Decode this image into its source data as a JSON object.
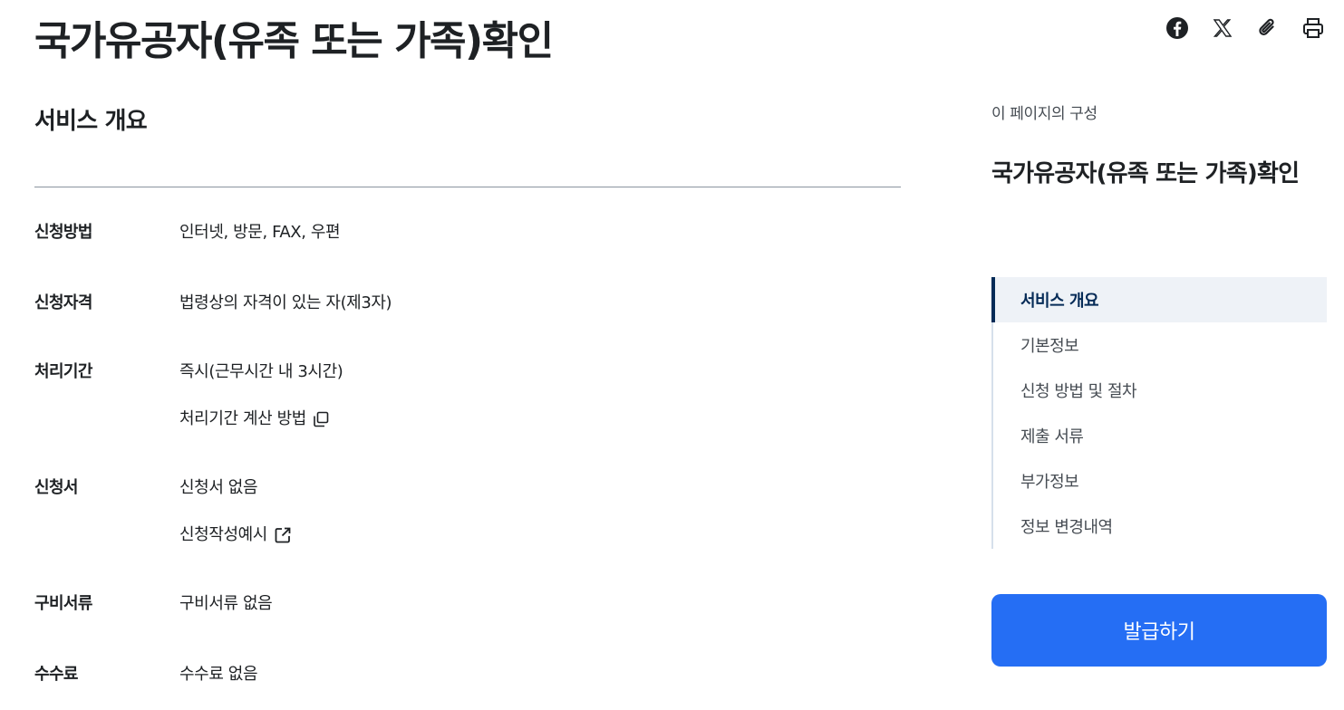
{
  "page": {
    "title": "국가유공자(유족 또는 가족)확인"
  },
  "share": {
    "icons": [
      "facebook-icon",
      "x-icon",
      "paperclip-icon",
      "print-icon"
    ]
  },
  "overview": {
    "section_title": "서비스 개요",
    "rows": [
      {
        "label": "신청방법",
        "values": [
          "인터넷, 방문, FAX, 우편"
        ]
      },
      {
        "label": "신청자격",
        "values": [
          "법령상의 자격이 있는 자(제3자)"
        ]
      },
      {
        "label": "처리기간",
        "values": [
          "즉시(근무시간 내 3시간)",
          "처리기간 계산 방법"
        ]
      },
      {
        "label": "신청서",
        "values": [
          "신청서 없음",
          "신청작성예시"
        ]
      },
      {
        "label": "구비서류",
        "values": [
          "구비서류 없음"
        ]
      },
      {
        "label": "수수료",
        "values": [
          "수수료 없음"
        ]
      }
    ]
  },
  "toc": {
    "caption": "이 페이지의 구성",
    "title": "국가유공자(유족 또는 가족)확인",
    "items": [
      {
        "label": "서비스 개요",
        "active": true
      },
      {
        "label": "기본정보",
        "active": false
      },
      {
        "label": "신청 방법 및 절차",
        "active": false
      },
      {
        "label": "제출 서류",
        "active": false
      },
      {
        "label": "부가정보",
        "active": false
      },
      {
        "label": "정보 변경내역",
        "active": false
      }
    ]
  },
  "cta": {
    "label": "발급하기"
  },
  "colors": {
    "accent": "#256ef4",
    "toc_active": "#052b57",
    "text": "#1e2124"
  }
}
